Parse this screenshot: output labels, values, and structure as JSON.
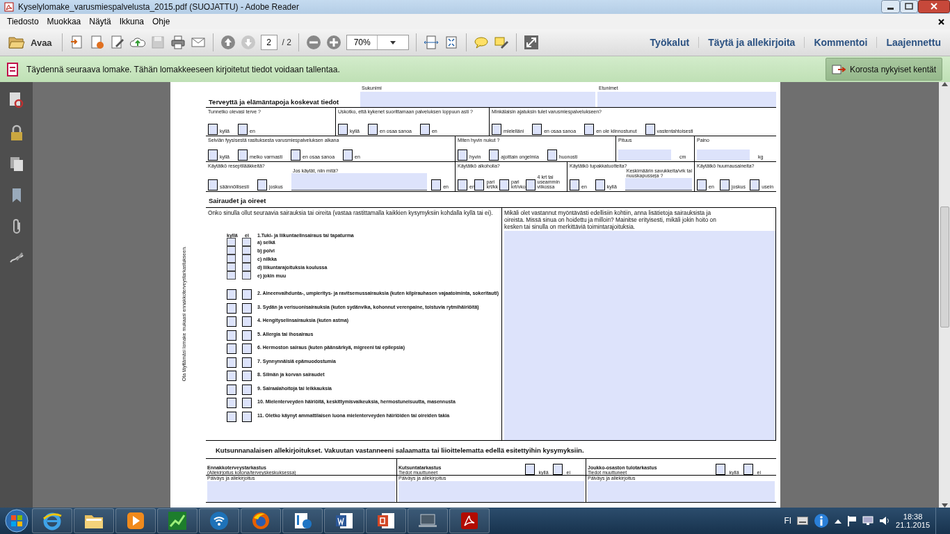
{
  "window": {
    "title": "Kyselylomake_varusmiespalvelusta_2015.pdf (SUOJATTU) - Adobe Reader"
  },
  "menu": [
    {
      "label": "Tiedosto"
    },
    {
      "label": "Muokkaa"
    },
    {
      "label": "Näytä"
    },
    {
      "label": "Ikkuna"
    },
    {
      "label": "Ohje"
    }
  ],
  "toolbar": {
    "open_label": "Avaa",
    "page_number": "2",
    "page_total": "/ 2",
    "zoom": "70%"
  },
  "panels": [
    {
      "label": "Työkalut"
    },
    {
      "label": "Täytä ja allekirjoita"
    },
    {
      "label": "Kommentoi"
    },
    {
      "label": "Laajennettu"
    }
  ],
  "notice": {
    "text": "Täydennä seuraava lomake. Tähän lomakkeeseen kirjoitetut tiedot voidaan tallentaa.",
    "button": "Korosta nykyiset kentät"
  },
  "side_note": "Ota täyttämäsi lomake mukaasi ennakkoterveystarkastukseen.",
  "form": {
    "name_fields": [
      {
        "label": "Sukunimi"
      },
      {
        "label": "Etunimet"
      }
    ],
    "health_title": "Terveyttä ja elämäntapoja koskevat tiedot",
    "question_rows": [
      [
        {
          "question": "Tunnetko olevasi terve ?",
          "options": [
            {
              "kind": "checkbox",
              "label": "kyllä",
              "checked": false
            },
            {
              "kind": "checkbox",
              "label": "en",
              "checked": false
            }
          ]
        },
        {
          "question": "Uskotko, että kykenet suorittamaan palveluksen loppuun asti ?",
          "options": [
            {
              "kind": "checkbox",
              "label": "kyllä",
              "checked": false
            },
            {
              "kind": "checkbox",
              "label": "en osaa sanoa",
              "checked": false
            },
            {
              "kind": "checkbox",
              "label": "en",
              "checked": false
            }
          ]
        },
        {
          "question": "Minkälaisin ajatuksin tulet varusmiespalvelukseen?",
          "options": [
            {
              "kind": "checkbox",
              "label": "mielelläni",
              "checked": false
            },
            {
              "kind": "checkbox",
              "label": "en osaa sanoa",
              "checked": false
            },
            {
              "kind": "checkbox",
              "label": "en ole kiinnostunut",
              "checked": false
            },
            {
              "kind": "checkbox",
              "label": "vastentahtoisesti",
              "checked": false
            }
          ]
        }
      ],
      [
        {
          "question": "Selviän fyysisestä rasituksesta varusmiespalveluksen alkana",
          "options": [
            {
              "kind": "checkbox",
              "label": "kyllä",
              "checked": false
            },
            {
              "kind": "checkbox",
              "label": "melko varmasti",
              "checked": false
            },
            {
              "kind": "checkbox",
              "label": "en osaa sanoa",
              "checked": false
            },
            {
              "kind": "checkbox",
              "label": "en",
              "checked": false
            }
          ]
        },
        {
          "question": "Miten hyvin nukut ?",
          "options": [
            {
              "kind": "checkbox",
              "label": "hyvin",
              "checked": false
            },
            {
              "kind": "checkbox",
              "label": "ajoittain ongelmia",
              "checked": false
            },
            {
              "kind": "checkbox",
              "label": "huonosti",
              "checked": false
            }
          ]
        },
        {
          "question": "Pituus",
          "options": [
            {
              "kind": "field",
              "unit": "cm"
            }
          ]
        },
        {
          "question": "Paino",
          "options": [
            {
              "kind": "field",
              "unit": "kg"
            }
          ]
        }
      ],
      [
        {
          "question": "Käytätkö reseptilääkkeitä?",
          "options": [
            {
              "kind": "checkbox",
              "label": "säännöllisesti",
              "checked": false
            },
            {
              "kind": "checkbox",
              "label": "joskus",
              "checked": false
            },
            {
              "kind": "field",
              "label": "Jos käytät, niin mitä?"
            },
            {
              "kind": "checkbox",
              "label": "en",
              "checked": false
            }
          ]
        },
        {
          "question": "Käytätkö alkoholia?",
          "options": [
            {
              "kind": "checkbox",
              "label": "en",
              "checked": false
            },
            {
              "kind": "checkbox",
              "label": "pari krt/kk",
              "checked": false
            },
            {
              "kind": "checkbox",
              "label": "pari krt/vko",
              "checked": false
            },
            {
              "kind": "checkbox",
              "label": "4 krt tai useammin viikossa",
              "checked": false
            }
          ]
        },
        {
          "question": "Käytätkö tupakkatuotteita?",
          "options": [
            {
              "kind": "checkbox",
              "label": "en",
              "checked": false
            },
            {
              "kind": "checkbox",
              "label": "kyllä",
              "checked": false
            },
            {
              "kind": "field",
              "label": "Keskimäärin savukkeita/vrk tai nuuskapusseja ?"
            }
          ]
        },
        {
          "question": "Käytätkö huumausaineita?",
          "options": [
            {
              "kind": "checkbox",
              "label": "en",
              "checked": false
            },
            {
              "kind": "checkbox",
              "label": "joskus",
              "checked": false
            },
            {
              "kind": "checkbox",
              "label": "usein",
              "checked": false
            }
          ]
        }
      ]
    ],
    "illness_title": "Sairaudet ja oireet",
    "illness_intro": "Onko sinulla ollut seuraavia sairauksia tai oireita (vastaa rastittamalla kaikkien kysymyksiin kohdalla kyllä tai ei).",
    "answer_headers": [
      "kyllä",
      "ei"
    ],
    "illnesses": [
      {
        "label": "1.Tuki- ja liikuntaelinsairaus tai tapaturma",
        "children": [
          {
            "label": "a) selkä",
            "yes_checked": false,
            "no_checked": false
          },
          {
            "label": "b) polvi",
            "yes_checked": false,
            "no_checked": false
          },
          {
            "label": "c) nilkka",
            "yes_checked": false,
            "no_checked": false
          },
          {
            "label": "d) liikuntarajoituksia koulussa",
            "yes_checked": false,
            "no_checked": false
          },
          {
            "label": "e) jokin muu",
            "yes_checked": false,
            "no_checked": false
          }
        ]
      },
      {
        "label": "2. Aineenvaihdunta-, umpieritys- ja ravitsemussairauksia (kuten kilpirauhasen vajaatoiminta, sokeritauti)",
        "yes_checked": false,
        "no_checked": false
      },
      {
        "label": "3. Sydän ja verisuonisairauksia (kuten sydänvika, kohonnut verenpaine, toistuvia rytmihäiriöitä)",
        "yes_checked": false,
        "no_checked": false
      },
      {
        "label": "4. Hengityselinsairauksia (kuten astma)",
        "yes_checked": false,
        "no_checked": false
      },
      {
        "label": "5. Allergia tai ihosairaus",
        "yes_checked": false,
        "no_checked": false
      },
      {
        "label": "6. Hermoston sairaus (kuten päänsärkyä, migreeni tai epilepsia)",
        "yes_checked": false,
        "no_checked": false
      },
      {
        "label": "7. Synnynnäisiä epämuodostumia",
        "yes_checked": false,
        "no_checked": false
      },
      {
        "label": "8. Silmän ja korvan sairaudet",
        "yes_checked": false,
        "no_checked": false
      },
      {
        "label": "9. Sairaalahoitoja tai leikkauksia",
        "yes_checked": false,
        "no_checked": false
      },
      {
        "label": "10. Mielenterveyden häiriöitä, keskittymisvaikeuksia, hermostuneisuutta, masennusta",
        "yes_checked": false,
        "no_checked": false
      },
      {
        "label": "11. Oletko käynyt ammattilaisen luona mielenterveyden häiriöiden tai oireiden takia",
        "yes_checked": false,
        "no_checked": false
      }
    ],
    "details_prompt": "Mikäli olet vastannut myöntävästi edellisiin kohtiin, anna lisätietoja sairauksista ja oireista. Missä sinua on hoidettu ja milloin? Mainitse erityisesti, mikäli jokin hoito on kesken tai sinulla on merkittäviä toimintarajoituksia.",
    "signature_title": "Kutsunnanalaisen allekirjoitukset. Vakuutan vastanneeni salaamatta tai liioittelematta edellä esitettyihin kysymyksiin.",
    "signatures": [
      {
        "title": "Ennakkoterveystarkastus",
        "subtitle": "(Allekirjoitus kotona/terveyskeskuksessa)",
        "field_label": "Päiväys ja allekirjoitus"
      },
      {
        "title": "Kutsuntatarkastus",
        "subtitle": "Tiedot muuttuneet",
        "options": [
          {
            "label": "kyllä",
            "checked": false
          },
          {
            "label": "ei",
            "checked": false
          }
        ],
        "field_label": "Päiväys ja allekirjoitus"
      },
      {
        "title": "Joukko-osaston tulotarkastus",
        "subtitle": "Tiedot muuttuneet",
        "options": [
          {
            "label": "kyllä",
            "checked": false
          },
          {
            "label": "ei",
            "checked": false
          }
        ],
        "field_label": "Päiväys ja allekirjoitus"
      }
    ]
  },
  "taskbar": {
    "apps": [
      {
        "kind": "ie"
      },
      {
        "kind": "folder"
      },
      {
        "kind": "media"
      },
      {
        "kind": "chart"
      },
      {
        "kind": "wifi"
      },
      {
        "kind": "firefox"
      },
      {
        "kind": "lync"
      },
      {
        "kind": "word"
      },
      {
        "kind": "powerpoint"
      },
      {
        "kind": "computer"
      },
      {
        "kind": "acrobat"
      }
    ],
    "language": "FI",
    "time": "18:38",
    "date": "21.1.2015"
  }
}
